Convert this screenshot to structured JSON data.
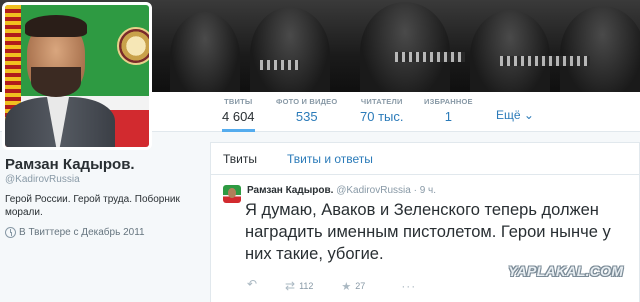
{
  "profile": {
    "name": "Рамзан Кадыров.",
    "handle": "@KadirovRussia",
    "bio": "Герой России. Герой труда. Поборник морали.",
    "joined": "В Твиттере с Декабрь 2011"
  },
  "stats": [
    {
      "label": "ТВИТЫ",
      "value": "4 604"
    },
    {
      "label": "ФОТО И ВИДЕО",
      "value": "535"
    },
    {
      "label": "ЧИТАТЕЛИ",
      "value": "70 тыс."
    },
    {
      "label": "ИЗБРАННОЕ",
      "value": "1"
    }
  ],
  "more_label": "Ещё",
  "tabs": {
    "tweets": "Твиты",
    "tweets_replies": "Твиты и ответы"
  },
  "tweet": {
    "name": "Рамзан Кадыров.",
    "handle": "@KadirovRussia",
    "time": "· 9 ч.",
    "text": "Я думаю, Аваков и Зеленского теперь должен наградить именным пистолетом. Герои нынче у них такие, убогие.",
    "retweets": "112",
    "favorites": "27"
  },
  "watermark": "YAPLAKAL.COM",
  "colors": {
    "link": "#2b7bb9",
    "accent": "#55acee",
    "muted": "#8899a6",
    "text": "#292f33"
  }
}
